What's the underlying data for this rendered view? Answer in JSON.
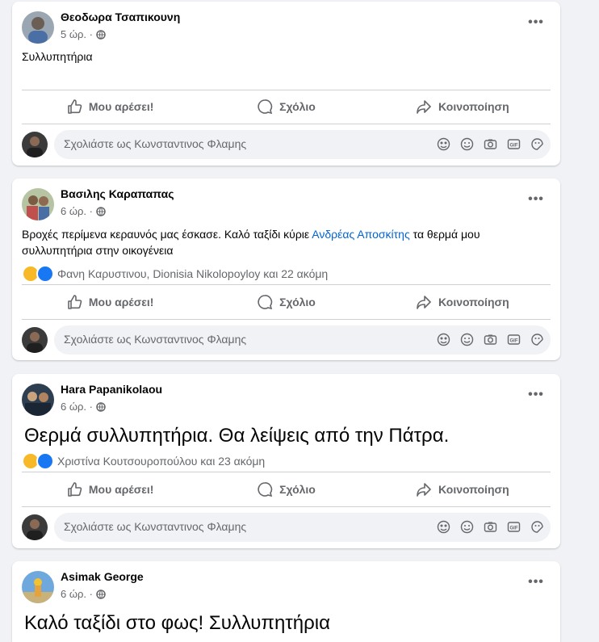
{
  "actions": {
    "like": "Μου αρέσει!",
    "comment": "Σχόλιο",
    "share": "Κοινοποίηση"
  },
  "comment_placeholder": "Σχολιάστε ως Κωνσταντινος Φλαμης",
  "comment_icons": [
    "emoji-avatar-icon",
    "smiley-icon",
    "camera-icon",
    "gif-icon",
    "sticker-icon"
  ],
  "colors": {
    "link": "#0064d1",
    "secondary_text": "#65676b",
    "background": "#f0f2f5"
  },
  "posts": [
    {
      "author": "Θεοδωρα Τσαπικουνη",
      "time": "5 ώρ. ·",
      "text": "Συλλυπητήρια"
    },
    {
      "author": "Βασιλης Καραπαπας",
      "time": "6 ώρ. ·",
      "text_before": "Βροχές περίμενα κεραυνός μας έσκασε. Καλό ταξίδι κύριε ",
      "mention": "Ανδρέας Αποσκίτης",
      "text_after": " τα θερμά μου συλλυπητήρια στην οικογένεια",
      "reactions": "Φανη Καρυστινου, Dionisia Nikolopoyloy και 22 ακόμη"
    },
    {
      "author": "Hara Papanikolaou",
      "time": "6 ώρ. ·",
      "text": "Θερμά συλλυπητήρια. Θα λείψεις από την Πάτρα.",
      "reactions": "Χριστίνα Κουτσουροπούλου και 23 ακόμη"
    },
    {
      "author": "Asimak George",
      "time": "6 ώρ. ·",
      "text": "Καλό ταξίδι στο φως! Συλλυπητήρια"
    }
  ]
}
